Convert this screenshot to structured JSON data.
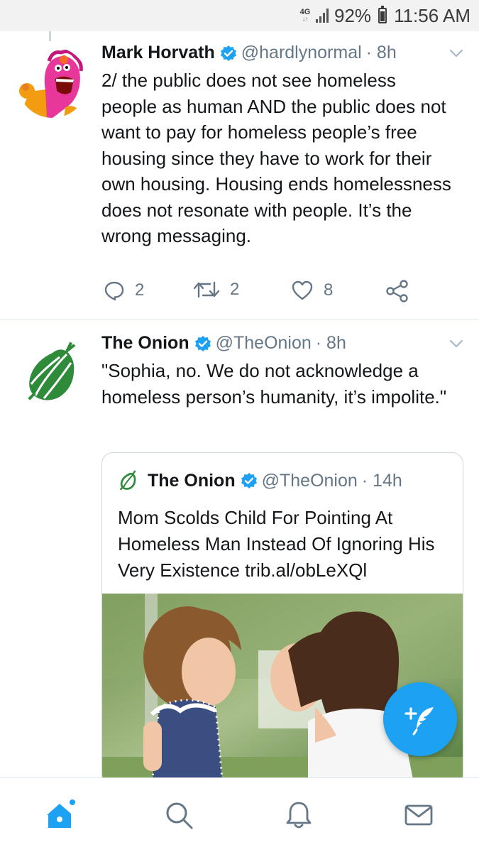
{
  "status_bar": {
    "network": "4G",
    "battery": "92%",
    "time": "11:56 AM"
  },
  "tweets": [
    {
      "name": "Mark Horvath",
      "handle": "@hardlynormal",
      "time": "· 8h",
      "text": "2/ the public does not see homeless people as human AND the public does not want to pay for homeless people’s free housing since they have to work for their own housing. Housing ends homelessness does not resonate with people. It’s the wrong messaging.",
      "replies": "2",
      "retweets": "2",
      "likes": "8"
    },
    {
      "name": "The Onion",
      "handle": "@TheOnion",
      "time": "· 8h",
      "text": "\"Sophia, no. We do not acknowledge a homeless person’s humanity, it’s impolite.\"",
      "quote": {
        "name": "The Onion",
        "handle": "@TheOnion",
        "time": "· 14h",
        "text": "Mom Scolds Child For Pointing At Homeless Man Instead Of Ignoring His Very Existence trib.al/obLeXQl"
      }
    }
  ],
  "colors": {
    "accent": "#1da1f2",
    "onion_green": "#2e8b3a",
    "secondary_text": "#657786"
  },
  "icons": [
    "verified-badge-icon",
    "chevron-down-icon",
    "reply-icon",
    "retweet-icon",
    "like-icon",
    "share-icon",
    "compose-tweet-icon",
    "home-icon",
    "search-icon",
    "notifications-icon",
    "messages-icon"
  ]
}
